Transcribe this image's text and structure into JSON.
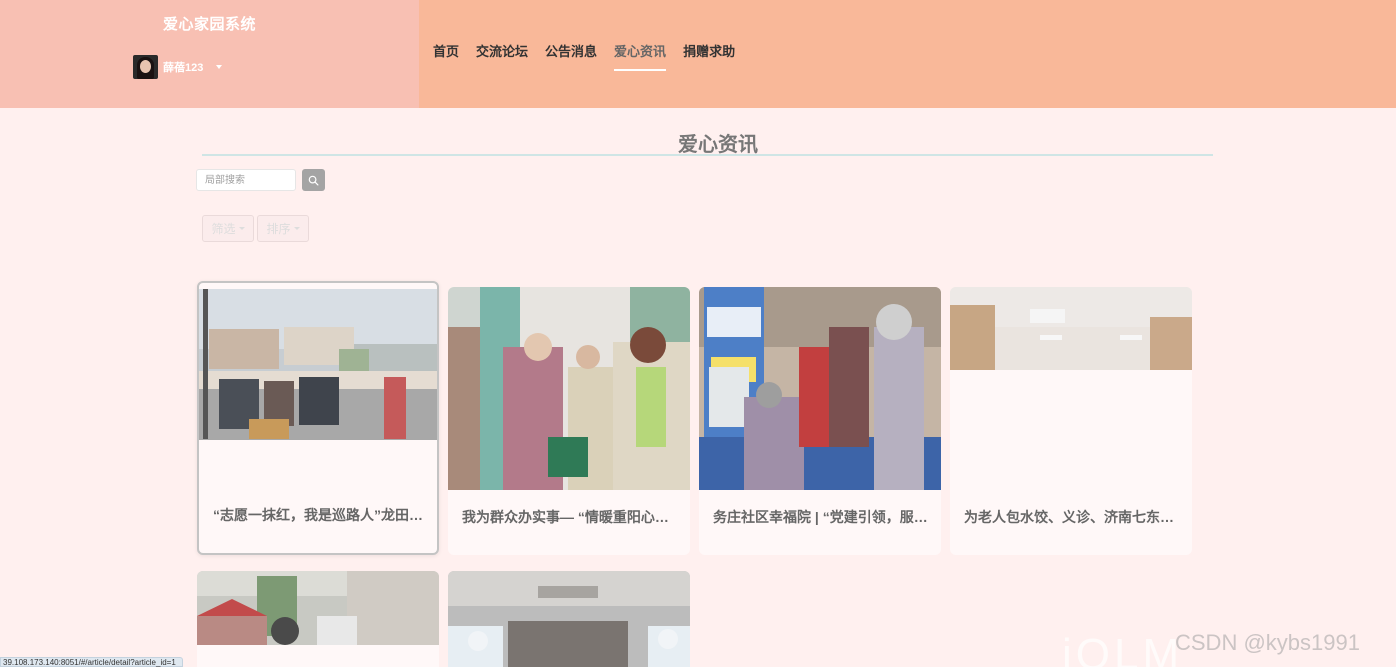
{
  "header": {
    "brand_title": "爱心家园系统",
    "username": "薛蓓123",
    "nav": [
      {
        "label": "首页"
      },
      {
        "label": "交流论坛"
      },
      {
        "label": "公告消息"
      },
      {
        "label": "爱心资讯",
        "active": true
      },
      {
        "label": "捐赠求助"
      }
    ]
  },
  "page": {
    "title": "爱心资讯"
  },
  "search": {
    "placeholder": "局部搜索"
  },
  "filters": {
    "filter_label": "筛选",
    "sort_label": "排序"
  },
  "articles": [
    {
      "caption": "“志愿一抹红，我是巡路人”龙田街道重阳节志愿活动"
    },
    {
      "caption": "我为群众办实事— “情暖重阳心连心”敬老活动"
    },
    {
      "caption": "务庄社区幸福院 | “党建引领，服务为民”"
    },
    {
      "caption": "为老人包水饺、义诊、济南七东社区重阳节活动"
    },
    {
      "caption": ""
    },
    {
      "caption": ""
    }
  ],
  "status_url": "39.108.173.140:8051/#/article/detail?article_id=1",
  "watermark": "CSDN @kybs1991"
}
